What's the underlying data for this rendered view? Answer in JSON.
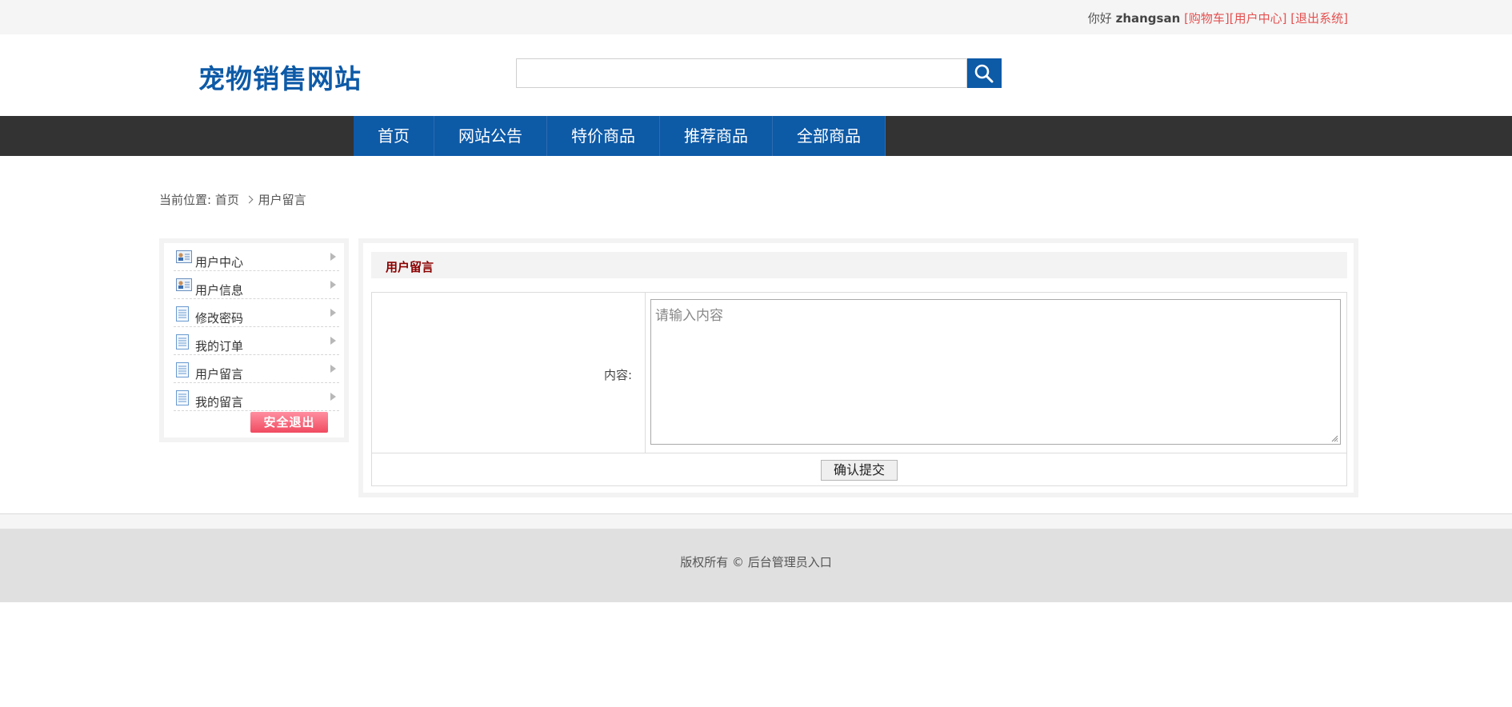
{
  "topbar": {
    "greeting": "你好",
    "username": "zhangsan",
    "links": [
      "[购物车]",
      "[用户中心]",
      "[退出系统]"
    ]
  },
  "header": {
    "logo": "宠物销售网站",
    "search_value": "",
    "search_icon": "search-icon"
  },
  "nav": {
    "items": [
      "首页",
      "网站公告",
      "特价商品",
      "推荐商品",
      "全部商品"
    ]
  },
  "breadcrumb": {
    "prefix": "当前位置:",
    "home": "首页",
    "current": "用户留言"
  },
  "sidebar": {
    "items": [
      {
        "label": "用户中心",
        "icon": "id-card-icon"
      },
      {
        "label": "用户信息",
        "icon": "id-card-icon"
      },
      {
        "label": "修改密码",
        "icon": "document-icon"
      },
      {
        "label": "我的订单",
        "icon": "document-icon"
      },
      {
        "label": "用户留言",
        "icon": "document-icon"
      },
      {
        "label": "我的留言",
        "icon": "document-icon"
      }
    ],
    "logout_label": "安全退出"
  },
  "main": {
    "title": "用户留言",
    "content_label": "内容:",
    "content_placeholder": "请输入内容",
    "submit_label": "确认提交"
  },
  "footer": {
    "copyright": "版权所有 ©",
    "admin_link": "后台管理员入口"
  },
  "colors": {
    "brand_blue": "#0d5aa7",
    "nav_bg": "#333333",
    "title_red": "#8b0000",
    "link_red": "#e45050"
  }
}
